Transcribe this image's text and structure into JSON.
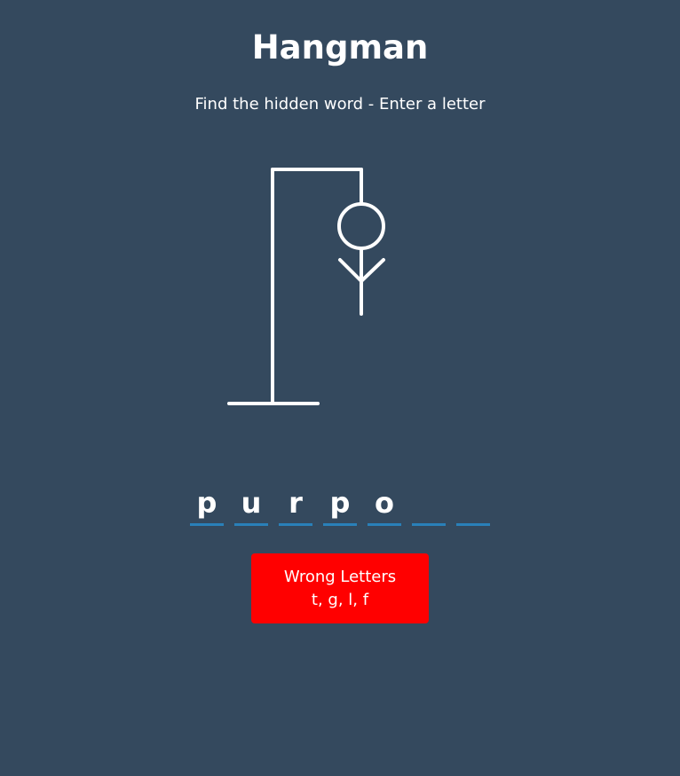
{
  "header": {
    "title": "Hangman",
    "subtitle": "Find the hidden word - Enter a letter"
  },
  "game": {
    "word_slots": [
      "p",
      "u",
      "r",
      "p",
      "o",
      "",
      ""
    ],
    "drawn_parts": [
      "head",
      "body",
      "left-arm",
      "right-arm"
    ],
    "underline_color": "#2980b9",
    "figure_color": "#ffffff"
  },
  "wrong_letters": {
    "label": "Wrong Letters",
    "letters": "t, g, l, f",
    "background_color": "#ff0000"
  },
  "theme": {
    "background_color": "#34495e"
  }
}
